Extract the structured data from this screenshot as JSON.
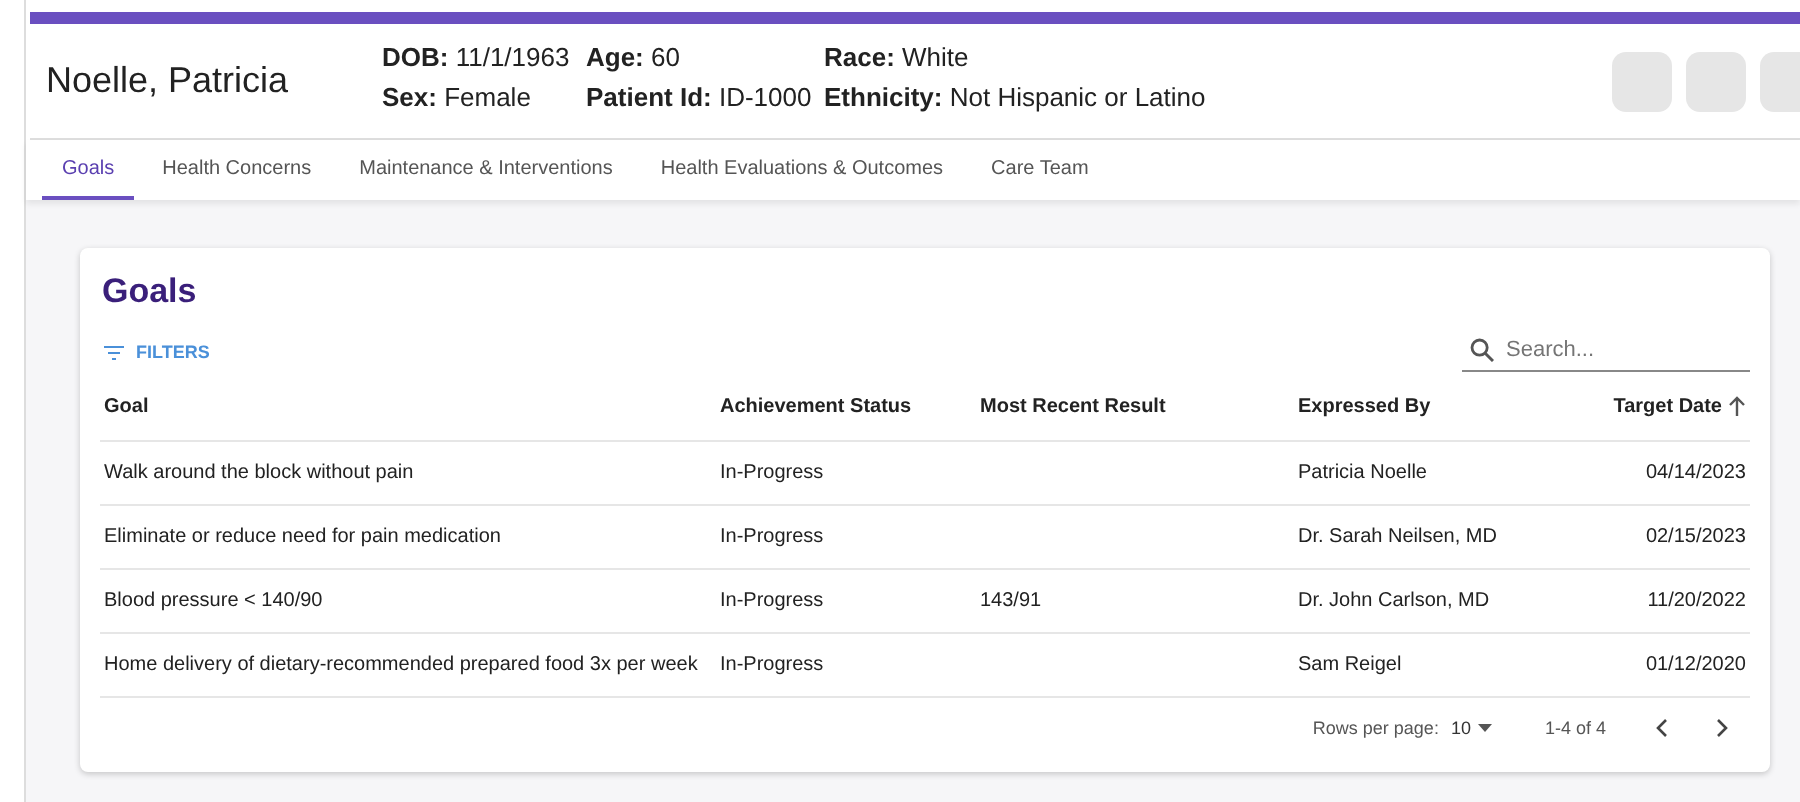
{
  "patient": {
    "name": "Noelle, Patricia",
    "fields": [
      {
        "text": "**DOB:** 11/1/1963"
      },
      {
        "text": "**Sex:** Female"
      },
      {
        "text": "**Age:** 60"
      },
      {
        "text": "**Patient Id:** ID-1000"
      },
      {
        "text": "**Race:** White"
      },
      {
        "text": "**Ethnicity:** Not Hispanic or Latino"
      }
    ],
    "action_buttons": [
      {
        "kind": "blank"
      },
      {
        "kind": "blank"
      },
      {
        "kind": "blank"
      }
    ]
  },
  "tabs": [
    {
      "label": "Goals",
      "selected": true
    },
    {
      "label": "Health Concerns",
      "selected": false
    },
    {
      "label": "Maintenance & Interventions",
      "selected": false
    },
    {
      "label": "Health Evaluations & Outcomes",
      "selected": false
    },
    {
      "label": "Care Team",
      "selected": false
    }
  ],
  "goals": {
    "title": "Goals",
    "filters_label": "FILTERS",
    "search": {
      "placeholder": "Search..."
    },
    "columns": [
      {
        "label": "Goal",
        "sorted": false
      },
      {
        "label": "Achievement Status",
        "sorted": false
      },
      {
        "label": "Most Recent Result",
        "sorted": false
      },
      {
        "label": "Expressed By",
        "sorted": false
      },
      {
        "label": "Target Date",
        "sorted": true
      }
    ],
    "rows": [
      [
        "Walk around the block without pain",
        "In-Progress",
        "",
        "Patricia Noelle",
        "04/14/2023"
      ],
      [
        "Eliminate or reduce need for pain medication",
        "In-Progress",
        "",
        "Dr. Sarah Neilsen, MD",
        "02/15/2023"
      ],
      [
        "Blood pressure < 140/90",
        "In-Progress",
        "143/91",
        "Dr. John Carlson, MD",
        "11/20/2022"
      ],
      [
        "Home delivery of dietary-recommended prepared food 3x per week",
        "In-Progress",
        "",
        "Sam Reigel",
        "01/12/2020"
      ]
    ],
    "pagination": {
      "rows_per_page_label": "Rows per page:",
      "rows_per_page": "10",
      "range": "1-4 of 4"
    }
  }
}
